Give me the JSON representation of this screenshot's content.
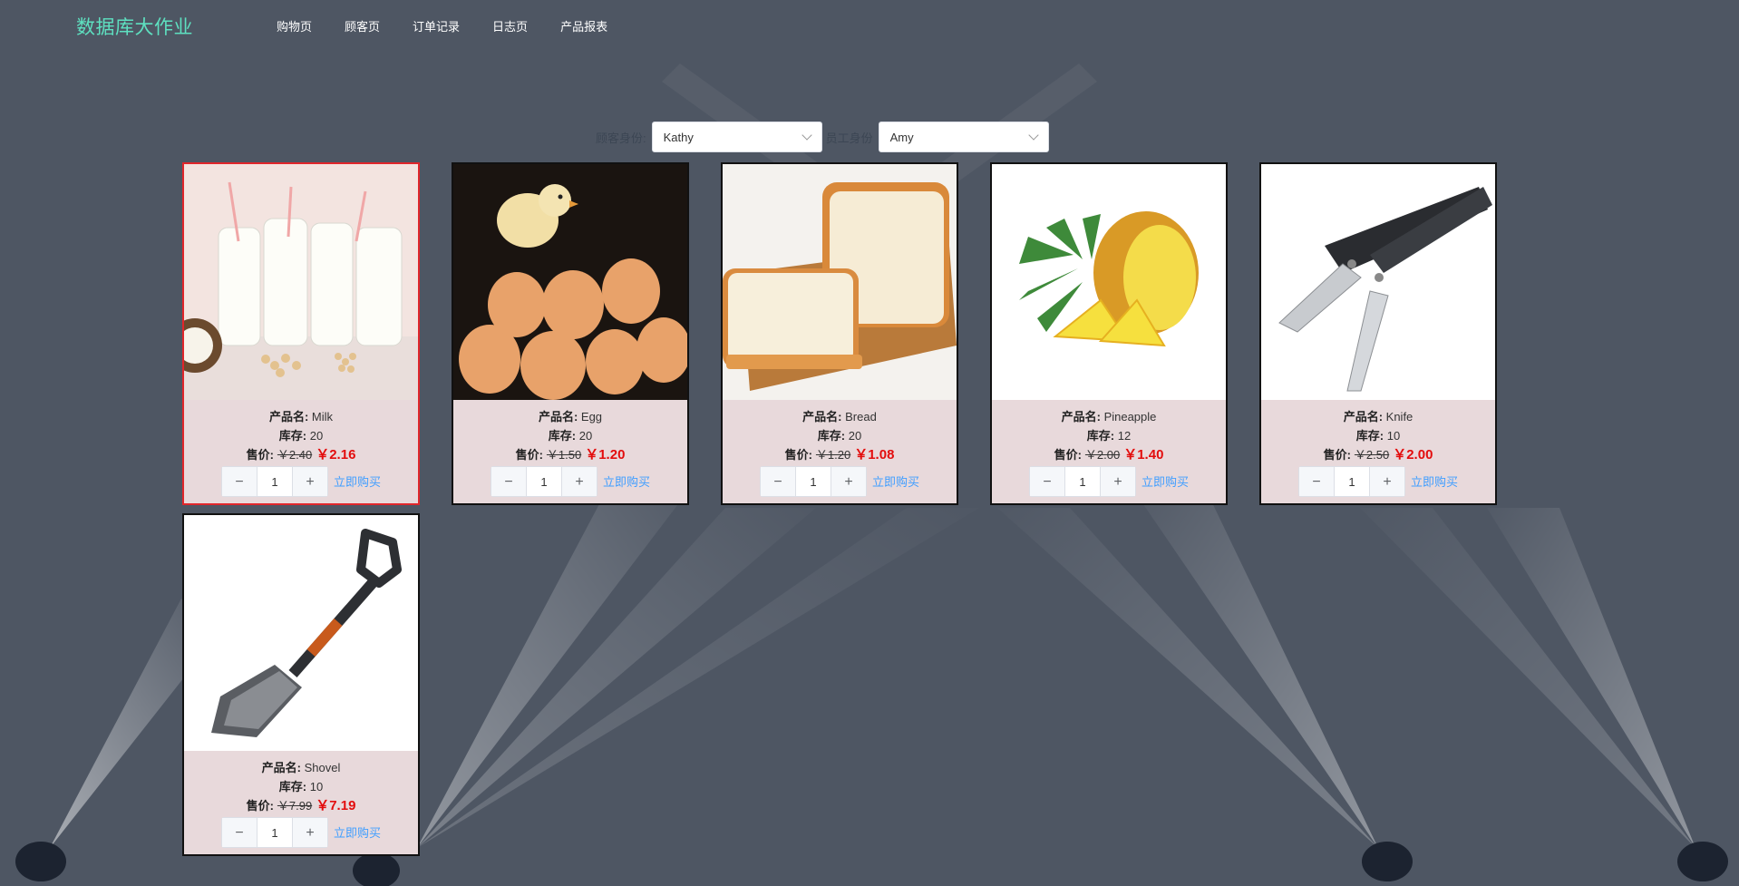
{
  "brand": "数据库大作业",
  "nav": [
    "购物页",
    "顾客页",
    "订单记录",
    "日志页",
    "产品报表"
  ],
  "selectors": {
    "customer_label": "顾客身份:",
    "customer_value": "Kathy",
    "employee_label": "员工身份",
    "employee_value": "Amy"
  },
  "labels": {
    "name": "产品名:",
    "stock": "库存:",
    "price": "售价:",
    "buy": "立即购买",
    "minus": "−",
    "plus": "+"
  },
  "products": [
    {
      "name": "Milk",
      "stock": "20",
      "old": "￥2.40",
      "new": "￥2.16",
      "qty": "1",
      "image": "milk-bottles"
    },
    {
      "name": "Egg",
      "stock": "20",
      "old": "￥1.50",
      "new": "￥1.20",
      "qty": "1",
      "image": "chick-eggs"
    },
    {
      "name": "Bread",
      "stock": "20",
      "old": "￥1.20",
      "new": "￥1.08",
      "qty": "1",
      "image": "bread-loaf"
    },
    {
      "name": "Pineapple",
      "stock": "12",
      "old": "￥2.00",
      "new": "￥1.40",
      "qty": "1",
      "image": "pineapple"
    },
    {
      "name": "Knife",
      "stock": "10",
      "old": "￥2.50",
      "new": "￥2.00",
      "qty": "1",
      "image": "folding-knives"
    },
    {
      "name": "Shovel",
      "stock": "10",
      "old": "￥7.99",
      "new": "￥7.19",
      "qty": "1",
      "image": "shovel"
    }
  ],
  "colors": {
    "background": "#4e5663",
    "brand": "#5ee0c0",
    "price_new": "#e30d0d",
    "link": "#409eff",
    "card": "#e8d9db",
    "selected_border": "#e0262b"
  }
}
